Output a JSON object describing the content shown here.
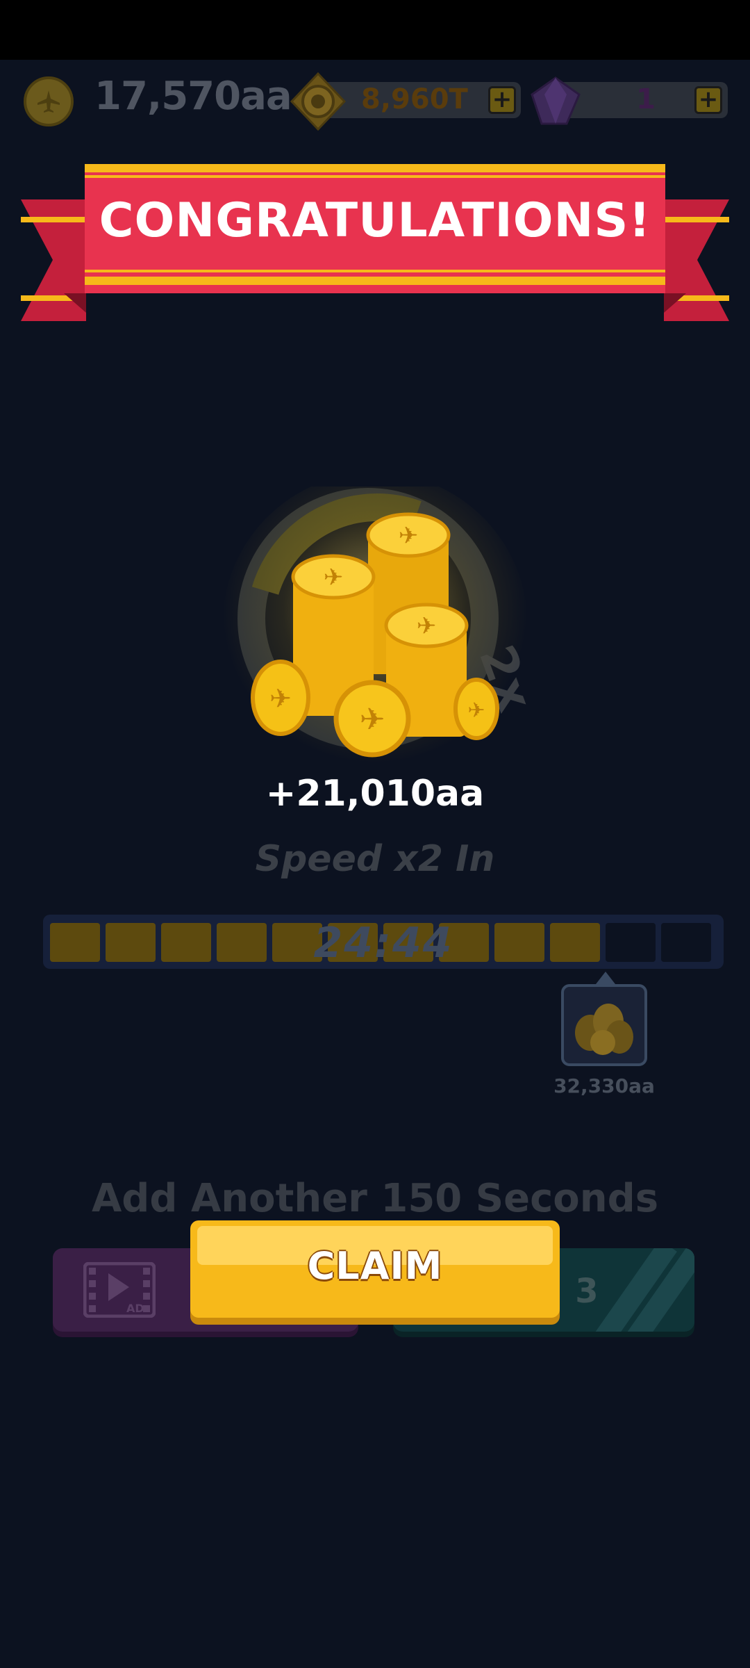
{
  "currency": {
    "coins": "17,570aa",
    "tokens": "8,960T",
    "gems": "1"
  },
  "banner": {
    "title": "CONGRATULATIONS!"
  },
  "reward": {
    "amount": "+21,010aa",
    "multiplier": "2x",
    "speed_label": "Speed x2 In"
  },
  "progress": {
    "timer": "24:44",
    "segments_total": 12,
    "segments_filled": 10,
    "milestone_value": "32,330aa"
  },
  "boost": {
    "title": "Add Another 150 Seconds",
    "ad_label": "AD",
    "speed_count": "3"
  },
  "claim": {
    "label": "CLAIM"
  },
  "colors": {
    "background": "#0c1220",
    "ribbon": "#e8334f",
    "ribbon_stripe": "#f7b91a",
    "claim": "#f7b91a",
    "coin_gold": "#f5c116"
  },
  "icons": {
    "coin": "plane-coin-icon",
    "token": "gear-token-icon",
    "gem": "purple-gem-icon",
    "plus": "plus-icon",
    "ad": "video-ad-icon",
    "reward": "coin-pile-icon"
  }
}
